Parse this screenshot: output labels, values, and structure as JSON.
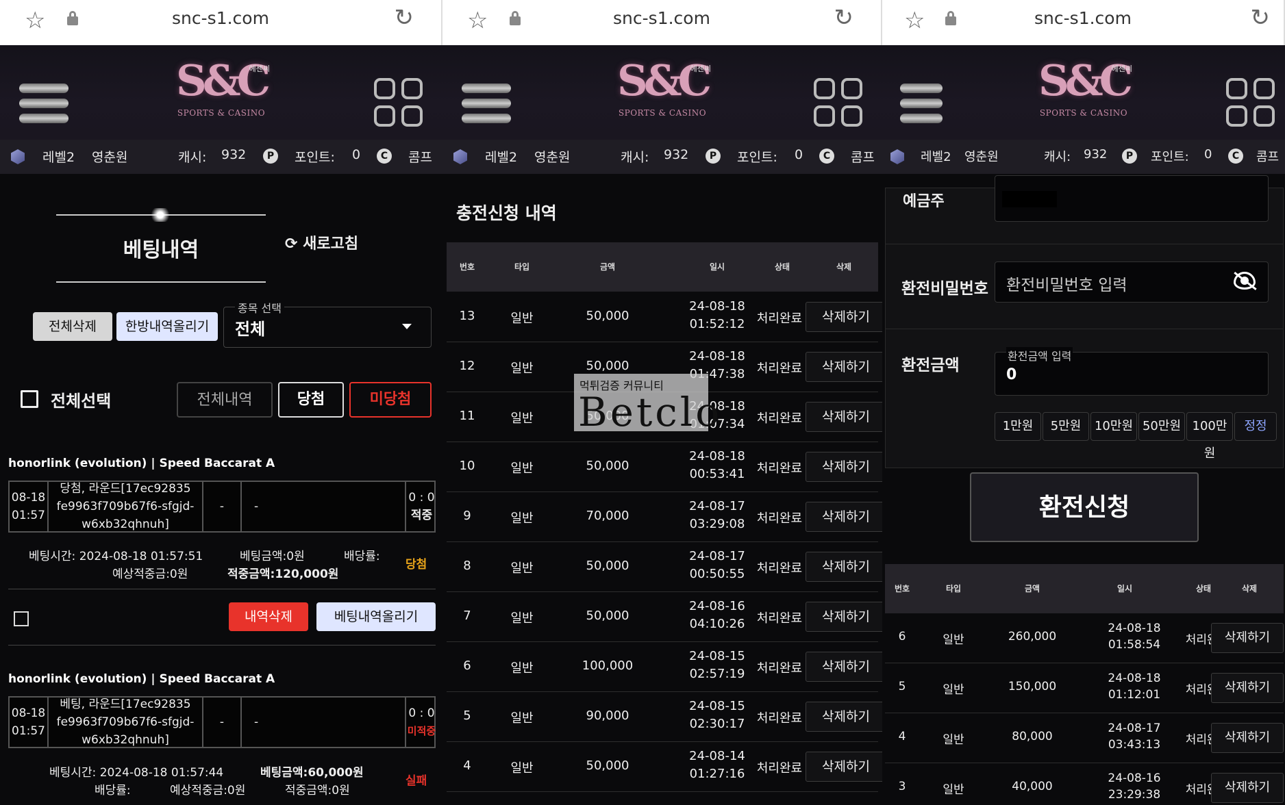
{
  "browser": {
    "domain": "snc-s1.com"
  },
  "header": {
    "logo_mark": "S&C",
    "logo_korean": "에센씨",
    "logo_tagline": "SPORTS & CASINO"
  },
  "status": {
    "level": "레벨2",
    "user": "영춘원",
    "cash_label": "캐시:",
    "cash_value": "932",
    "point_label": "포인트:",
    "point_value": "0",
    "comp_label": "콤프"
  },
  "panel1": {
    "title": "베팅내역",
    "refresh": "새로고침",
    "delete_all": "전체삭제",
    "upload_all": "한방내역올리기",
    "sport_select_label": "종목 선택",
    "sport_select_value": "전체",
    "select_all": "전체선택",
    "filters": [
      "전체내역",
      "당첨",
      "미당첨"
    ],
    "bets": [
      {
        "game": "honorlink (evolution) | Speed Baccarat A",
        "date": "08-18",
        "time": "01:57",
        "detail_1": "당첨, 라운드[17ec92835",
        "detail_2": "fe9963f709b67f6-sfgjd-",
        "detail_3": "w6xb32qhnuh]",
        "col_a": "-",
        "col_b": "-",
        "score": "0 : 0",
        "state": "적중",
        "bet_time": "베팅시간: 2024-08-18 01:57:51",
        "bet_amount": "베팅금액:0원",
        "odds": "배당률:",
        "expected": "예상적중금:0원",
        "won": "적중금액:120,000원",
        "result": "당첨"
      },
      {
        "game": "honorlink (evolution) | Speed Baccarat A",
        "date": "08-18",
        "time": "01:57",
        "detail_1": "베팅, 라운드[17ec92835",
        "detail_2": "fe9963f709b67f6-sfgjd-",
        "detail_3": "w6xb32qhnuh]",
        "col_a": "-",
        "col_b": "-",
        "score": "0 : 0",
        "state": "미적중",
        "bet_time": "베팅시간: 2024-08-18 01:57:44",
        "bet_amount": "베팅금액:60,000원",
        "odds": "배당률:",
        "expected": "예상적중금:0원",
        "won": "적중금액:0원",
        "result": "실패"
      }
    ],
    "delete_history": "내역삭제",
    "upload_history": "베팅내역올리기"
  },
  "panel2": {
    "title": "충전신청 내역",
    "columns": [
      "번호",
      "타입",
      "금액",
      "일시",
      "상태",
      "삭제"
    ],
    "rows": [
      {
        "no": "13",
        "type": "일반",
        "amount": "50,000",
        "date": "24-08-18",
        "time": "01:52:12",
        "status": "처리완료"
      },
      {
        "no": "12",
        "type": "일반",
        "amount": "50,000",
        "date": "24-08-18",
        "time": "01:47:38",
        "status": "처리완료"
      },
      {
        "no": "11",
        "type": "일반",
        "amount": "50,000",
        "date": "24-08-18",
        "time": "01:07:34",
        "status": "처리완료"
      },
      {
        "no": "10",
        "type": "일반",
        "amount": "50,000",
        "date": "24-08-18",
        "time": "00:53:41",
        "status": "처리완료"
      },
      {
        "no": "9",
        "type": "일반",
        "amount": "70,000",
        "date": "24-08-17",
        "time": "03:29:08",
        "status": "처리완료"
      },
      {
        "no": "8",
        "type": "일반",
        "amount": "50,000",
        "date": "24-08-17",
        "time": "00:50:55",
        "status": "처리완료"
      },
      {
        "no": "7",
        "type": "일반",
        "amount": "50,000",
        "date": "24-08-16",
        "time": "04:10:26",
        "status": "처리완료"
      },
      {
        "no": "6",
        "type": "일반",
        "amount": "100,000",
        "date": "24-08-15",
        "time": "02:57:19",
        "status": "처리완료"
      },
      {
        "no": "5",
        "type": "일반",
        "amount": "90,000",
        "date": "24-08-15",
        "time": "02:30:17",
        "status": "처리완료"
      },
      {
        "no": "4",
        "type": "일반",
        "amount": "50,000",
        "date": "24-08-14",
        "time": "01:27:16",
        "status": "처리완료"
      }
    ],
    "delete_label": "삭제하기",
    "watermark_line1": "먹튀검증 커뮤니티",
    "watermark_line2": "Betclo"
  },
  "panel3": {
    "depositor_label": "예금주",
    "pw_label": "환전비밀번호",
    "pw_placeholder": "환전비밀번호 입력",
    "amount_label": "환전금액",
    "amount_input_label": "환전금액 입력",
    "amount_value": "0",
    "quick_amounts": [
      "1만원",
      "5만원",
      "10만원",
      "50만원",
      "100만원"
    ],
    "reset": "정정",
    "submit": "환전신청",
    "columns": [
      "번호",
      "타입",
      "금액",
      "일시",
      "상태",
      "삭제"
    ],
    "rows": [
      {
        "no": "6",
        "type": "일반",
        "amount": "260,000",
        "date": "24-08-18",
        "time": "01:58:54",
        "status": "처리완료"
      },
      {
        "no": "5",
        "type": "일반",
        "amount": "150,000",
        "date": "24-08-18",
        "time": "01:12:01",
        "status": "처리완료"
      },
      {
        "no": "4",
        "type": "일반",
        "amount": "80,000",
        "date": "24-08-17",
        "time": "03:43:13",
        "status": "처리완료"
      },
      {
        "no": "3",
        "type": "일반",
        "amount": "40,000",
        "date": "24-08-16",
        "time": "23:29:38",
        "status": "처리완료"
      }
    ],
    "delete_label": "삭제하기"
  },
  "colors": {
    "accent_red": "#e8332b",
    "result_win": "#e8a41a",
    "result_loss": "#e8332b"
  }
}
